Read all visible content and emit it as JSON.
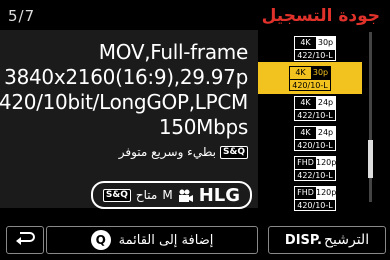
{
  "header": {
    "title": "جودة التسجيل",
    "page_indicator": "5/7"
  },
  "info": {
    "format_line": "MOV,Full-frame",
    "resolution_line": "3840x2160(16:9),29.97p",
    "codec_line": "420/10bit/LongGOP,LPCM",
    "bitrate_line": "150Mbps",
    "sq_support_label": "بطيء وسريع متوفر",
    "sq_badge": "S&Q",
    "hlg_label": "HLG",
    "hlg_mode_label": "متاح",
    "hlg_mode_m": "M",
    "hlg_sq_badge": "S&Q"
  },
  "list": {
    "items": [
      {
        "res": "4K",
        "fps": "30p",
        "spec": "422/10-L",
        "selected": false
      },
      {
        "res": "4K",
        "fps": "30p",
        "spec": "420/10-L",
        "selected": true
      },
      {
        "res": "4K",
        "fps": "24p",
        "spec": "422/10-L",
        "selected": false
      },
      {
        "res": "4K",
        "fps": "24p",
        "spec": "420/10-L",
        "selected": false
      },
      {
        "res": "FHD",
        "fps": "120p",
        "spec": "422/10-L",
        "selected": false
      },
      {
        "res": "FHD",
        "fps": "120p",
        "spec": "420/10-L",
        "selected": false
      }
    ],
    "scroll_position": 0.82
  },
  "footer": {
    "add_label": "إضافة إلى القائمة",
    "add_key": "Q",
    "filter_key": "DISP.",
    "filter_label": "الترشيح"
  },
  "colors": {
    "accent": "#f2c21f",
    "title": "#e0322b"
  }
}
